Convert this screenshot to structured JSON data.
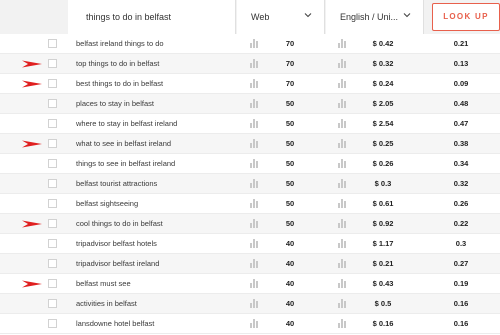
{
  "search": {
    "query": "things to do in belfast"
  },
  "filters": {
    "source": "Web",
    "language": "English / Uni..."
  },
  "lookup_label": "LOOK UP",
  "rows": [
    {
      "keyword": "belfast ireland things to do",
      "difficulty": "70",
      "cpc": "$ 0.42",
      "ppc": "0.21",
      "marked": false
    },
    {
      "keyword": "top things to do in belfast",
      "difficulty": "70",
      "cpc": "$ 0.32",
      "ppc": "0.13",
      "marked": true
    },
    {
      "keyword": "best things to do in belfast",
      "difficulty": "70",
      "cpc": "$ 0.24",
      "ppc": "0.09",
      "marked": true
    },
    {
      "keyword": "places to stay in belfast",
      "difficulty": "50",
      "cpc": "$ 2.05",
      "ppc": "0.48",
      "marked": false
    },
    {
      "keyword": "where to stay in belfast ireland",
      "difficulty": "50",
      "cpc": "$ 2.54",
      "ppc": "0.47",
      "marked": false
    },
    {
      "keyword": "what to see in belfast ireland",
      "difficulty": "50",
      "cpc": "$ 0.25",
      "ppc": "0.38",
      "marked": true
    },
    {
      "keyword": "things to see in belfast ireland",
      "difficulty": "50",
      "cpc": "$ 0.26",
      "ppc": "0.34",
      "marked": false
    },
    {
      "keyword": "belfast tourist attractions",
      "difficulty": "50",
      "cpc": "$ 0.3",
      "ppc": "0.32",
      "marked": false
    },
    {
      "keyword": "belfast sightseeing",
      "difficulty": "50",
      "cpc": "$ 0.61",
      "ppc": "0.26",
      "marked": false
    },
    {
      "keyword": "cool things to do in belfast",
      "difficulty": "50",
      "cpc": "$ 0.92",
      "ppc": "0.22",
      "marked": true
    },
    {
      "keyword": "tripadvisor belfast hotels",
      "difficulty": "40",
      "cpc": "$ 1.17",
      "ppc": "0.3",
      "marked": false
    },
    {
      "keyword": "tripadvisor belfast ireland",
      "difficulty": "40",
      "cpc": "$ 0.21",
      "ppc": "0.27",
      "marked": false
    },
    {
      "keyword": "belfast must see",
      "difficulty": "40",
      "cpc": "$ 0.43",
      "ppc": "0.19",
      "marked": true
    },
    {
      "keyword": "activities in belfast",
      "difficulty": "40",
      "cpc": "$ 0.5",
      "ppc": "0.16",
      "marked": false
    },
    {
      "keyword": "lansdowne hotel belfast",
      "difficulty": "40",
      "cpc": "$ 0.16",
      "ppc": "0.16",
      "marked": false
    }
  ],
  "colors": {
    "accent": "#e8604c",
    "arrow": "#e02020",
    "icon": "#c8c8c8"
  },
  "icons": {
    "chevron": "chevron-down-icon",
    "bars": "bar-chart-icon",
    "marker": "red-arrow-icon"
  }
}
